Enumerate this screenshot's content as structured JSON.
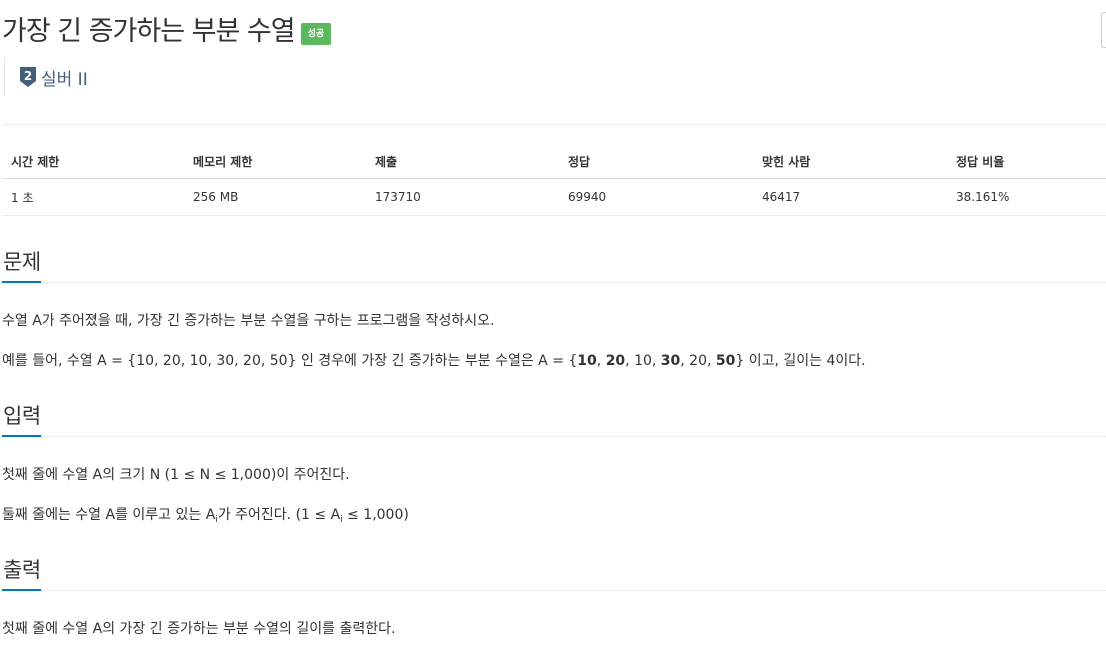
{
  "problem": {
    "title": "가장 긴 증가하는 부분 수열",
    "status_badge": "성공",
    "tier_number": "2",
    "tier_label": "실버 II"
  },
  "colors": {
    "badge_success": "#5cb85c",
    "tier_silver": "#435f7a",
    "section_accent": "#0076c0"
  },
  "info_table": {
    "headers": [
      "시간 제한",
      "메모리 제한",
      "제출",
      "정답",
      "맞힌 사람",
      "정답 비율"
    ],
    "values": [
      "1 초",
      "256 MB",
      "173710",
      "69940",
      "46417",
      "38.161%"
    ]
  },
  "description": {
    "title": "문제",
    "line1": "수열 A가 주어졌을 때, 가장 긴 증가하는 부분 수열을 구하는 프로그램을 작성하시오.",
    "line2_prefix": "예를 들어, 수열 A = {10, 20, 10, 30, 20, 50} 인 경우에 가장 긴 증가하는 부분 수열은 A = {",
    "line2_seq": [
      {
        "text": "10",
        "bold": true
      },
      {
        "text": ", ",
        "bold": false
      },
      {
        "text": "20",
        "bold": true
      },
      {
        "text": ", 10, ",
        "bold": false
      },
      {
        "text": "30",
        "bold": true
      },
      {
        "text": ", 20, ",
        "bold": false
      },
      {
        "text": "50",
        "bold": true
      }
    ],
    "line2_suffix": "} 이고, 길이는 4이다."
  },
  "input": {
    "title": "입력",
    "line1": "첫째 줄에 수열 A의 크기 N (1 ≤ N ≤ 1,000)이 주어진다.",
    "line2_a": "둘째 줄에는 수열 A를 이루고 있는 A",
    "line2_sub1": "i",
    "line2_b": "가 주어진다. (1 ≤ A",
    "line2_sub2": "i",
    "line2_c": " ≤ 1,000)"
  },
  "output": {
    "title": "출력",
    "line1": "첫째 줄에 수열 A의 가장 긴 증가하는 부분 수열의 길이를 출력한다."
  }
}
